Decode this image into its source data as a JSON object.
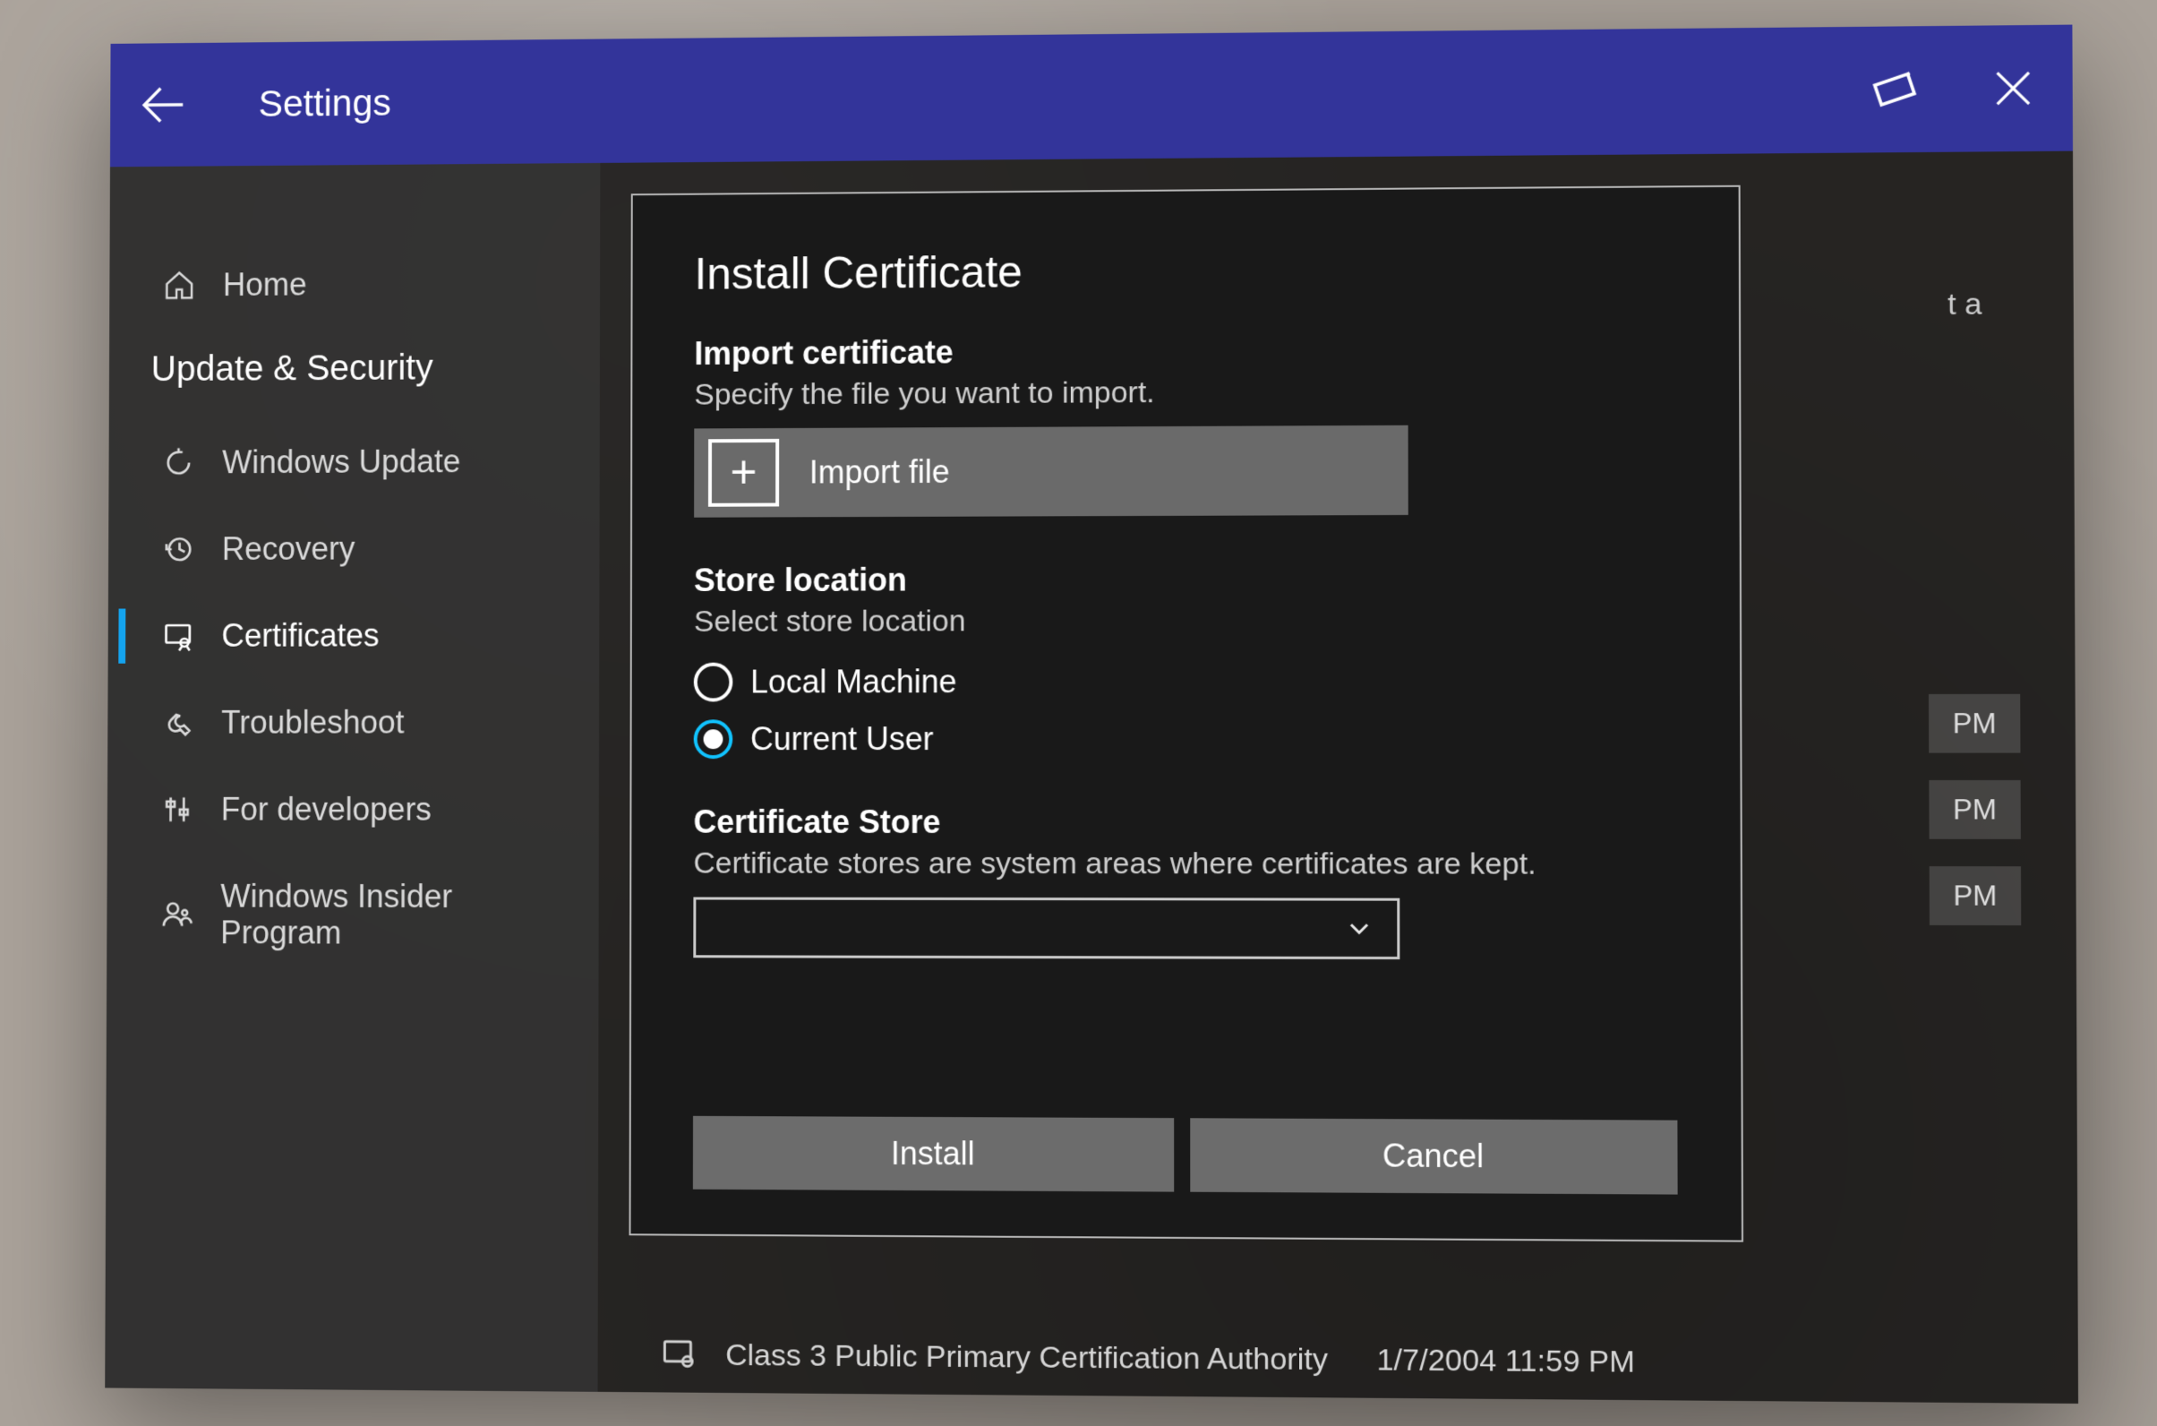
{
  "header": {
    "title": "Settings"
  },
  "sidebar": {
    "home": "Home",
    "section": "Update & Security",
    "items": [
      {
        "label": "Windows Update",
        "icon": "sync-icon"
      },
      {
        "label": "Recovery",
        "icon": "history-icon"
      },
      {
        "label": "Certificates",
        "icon": "certificate-icon"
      },
      {
        "label": "Troubleshoot",
        "icon": "wrench-icon"
      },
      {
        "label": "For developers",
        "icon": "tools-icon"
      },
      {
        "label": "Windows Insider Program",
        "icon": "person-icon"
      }
    ],
    "selected_index": 2
  },
  "dialog": {
    "title": "Install Certificate",
    "import_section_title": "Import certificate",
    "import_section_sub": "Specify the file you want to import.",
    "import_button_label": "Import file",
    "store_location_title": "Store location",
    "store_location_sub": "Select store location",
    "radio_options": [
      "Local Machine",
      "Current User"
    ],
    "radio_selected": 1,
    "cert_store_title": "Certificate Store",
    "cert_store_sub": "Certificate stores are system areas where certificates are kept.",
    "dropdown_value": "",
    "install_label": "Install",
    "cancel_label": "Cancel"
  },
  "background": {
    "partial_text": "t a",
    "rows": [
      "PM",
      "PM",
      "PM"
    ],
    "bottom_cert_name": "Class 3 Public Primary Certification Authority",
    "bottom_cert_time": "1/7/2004 11:59 PM"
  }
}
